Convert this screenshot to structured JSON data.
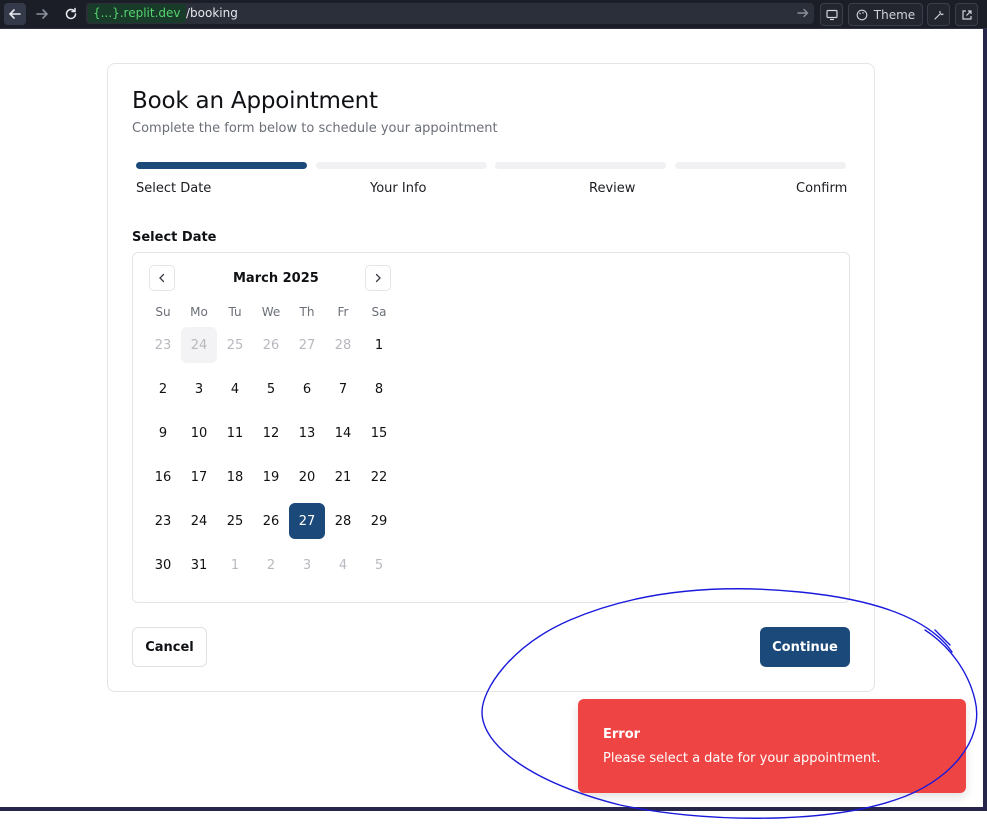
{
  "browser": {
    "host": "{...}.replit.dev",
    "path": "/booking",
    "theme_label": "Theme"
  },
  "booking": {
    "title": "Book an Appointment",
    "subtitle": "Complete the form below to schedule your appointment",
    "steps": [
      {
        "label": "Select Date",
        "active": true
      },
      {
        "label": "Your Info",
        "active": false
      },
      {
        "label": "Review",
        "active": false
      },
      {
        "label": "Confirm",
        "active": false
      }
    ],
    "section_label": "Select Date",
    "calendar": {
      "month": "March 2025",
      "weekdays": [
        "Su",
        "Mo",
        "Tu",
        "We",
        "Th",
        "Fr",
        "Sa"
      ],
      "weeks": [
        [
          "23",
          "24",
          "25",
          "26",
          "27",
          "28",
          "1"
        ],
        [
          "2",
          "3",
          "4",
          "5",
          "6",
          "7",
          "8"
        ],
        [
          "9",
          "10",
          "11",
          "12",
          "13",
          "14",
          "15"
        ],
        [
          "16",
          "17",
          "18",
          "19",
          "20",
          "21",
          "22"
        ],
        [
          "23",
          "24",
          "25",
          "26",
          "27",
          "28",
          "29"
        ],
        [
          "30",
          "31",
          "1",
          "2",
          "3",
          "4",
          "5"
        ]
      ],
      "selected_day": "27"
    },
    "cancel_label": "Cancel",
    "continue_label": "Continue"
  },
  "toast": {
    "title": "Error",
    "message": "Please select a date for your appointment."
  },
  "colors": {
    "primary": "#1b4a7a",
    "error": "#ef4444",
    "annotation": "#1a1adb"
  }
}
